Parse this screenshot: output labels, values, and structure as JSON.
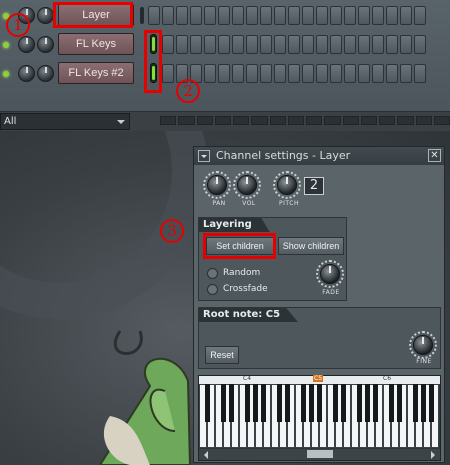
{
  "channel_rack": {
    "channels": [
      {
        "name": "Layer"
      },
      {
        "name": "FL Keys"
      },
      {
        "name": "FL Keys #2"
      }
    ],
    "filter": {
      "value": "All"
    }
  },
  "annotations": {
    "one": "1",
    "two": "2",
    "three": "3"
  },
  "channel_settings": {
    "title": "Channel settings - Layer",
    "close_label": "✕",
    "knobs": {
      "pan": "PAN",
      "vol": "VOL",
      "pitch": "PITCH"
    },
    "pitch_value": "2",
    "layering": {
      "tab": "Layering",
      "set_children": "Set children",
      "show_children": "Show children",
      "random": "Random",
      "crossfade": "Crossfade",
      "fade": "FADE"
    },
    "root_note": {
      "tab": "Root note: C5",
      "reset": "Reset",
      "fine": "FINE"
    },
    "keyboard": {
      "octaves": [
        "C4",
        "C5",
        "C6"
      ],
      "highlight": "C5"
    }
  },
  "colors": {
    "highlight_box": "#e60000",
    "led_on": "#7fe23b",
    "c5_marker": "#d9741b"
  }
}
